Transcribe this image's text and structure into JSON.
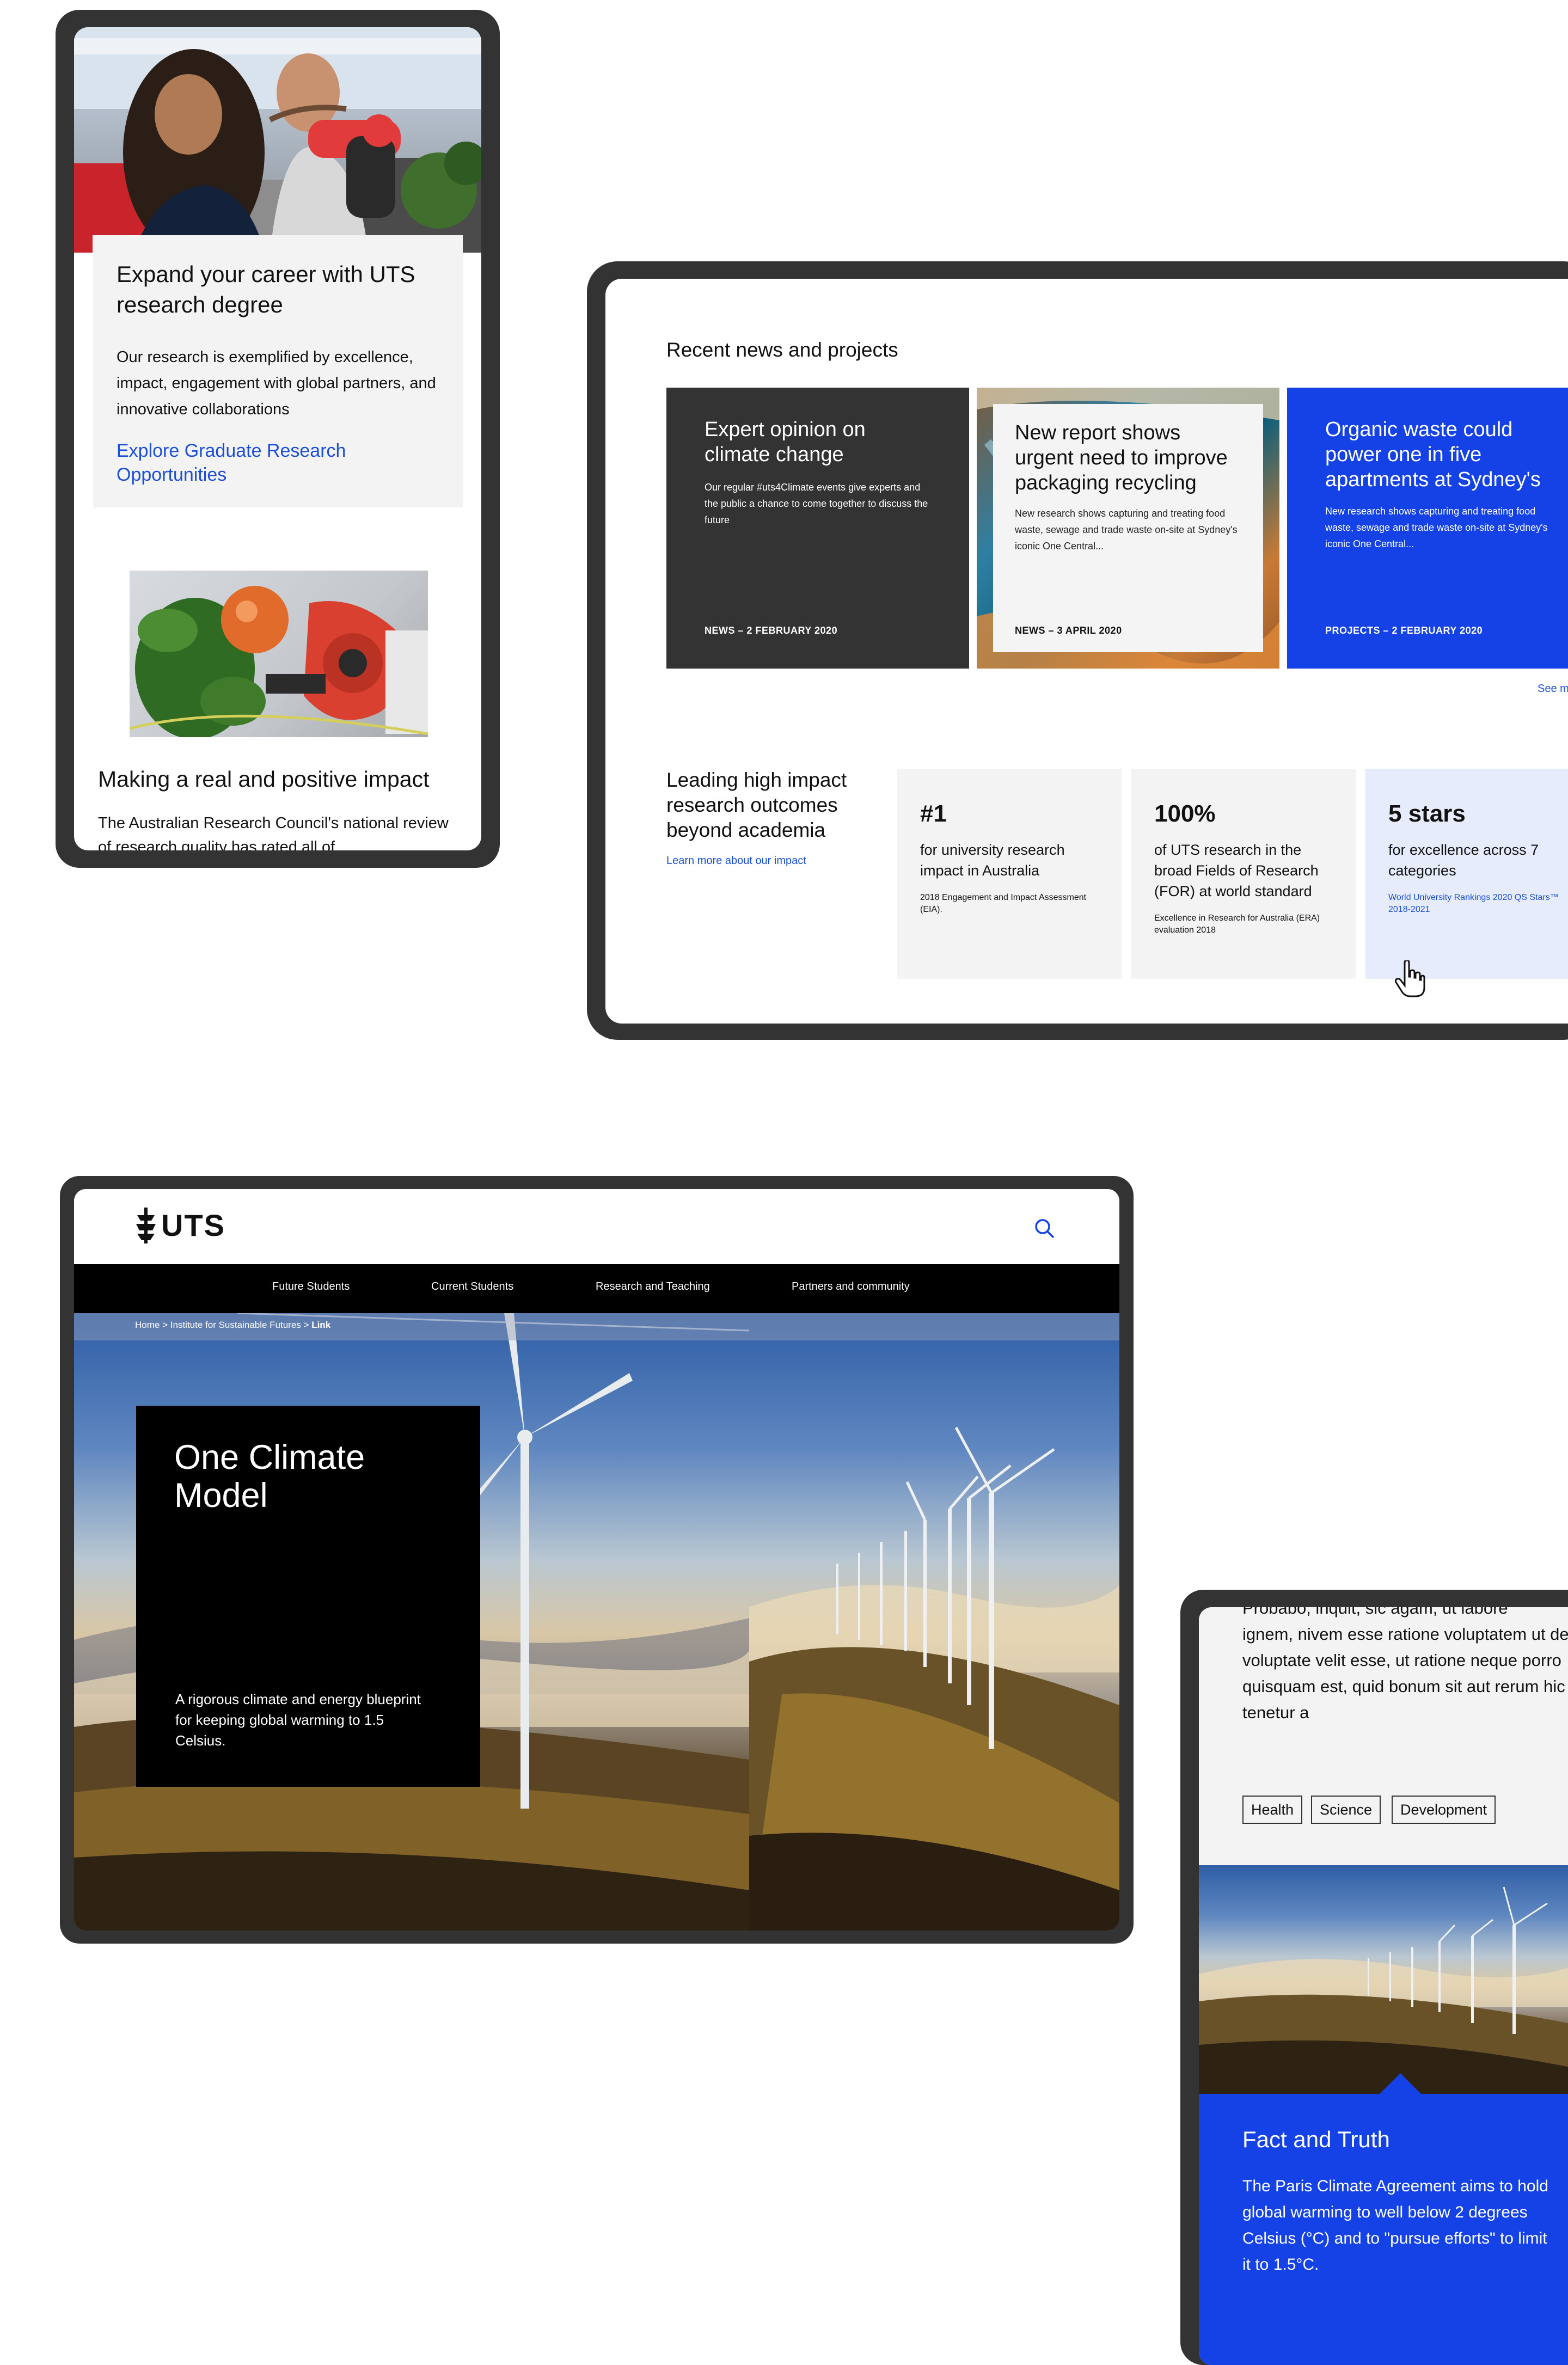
{
  "mobile_research": {
    "card1": {
      "title": "Expand your career with UTS research degree",
      "body": "Our research is exemplified by excellence, impact, engagement with global partners, and innovative collaborations",
      "link": "Explore Graduate Research Opportunities"
    },
    "card2": {
      "title": "Making a real and positive impact",
      "body": "The Australian Research Council's national review of research quality has rated all of"
    }
  },
  "tablet_news": {
    "section_title": "Recent news and projects",
    "cards": [
      {
        "title": "Expert opinion on climate change",
        "desc": "Our regular #uts4Climate events give experts and the public a chance to come together to discuss the future",
        "meta": "NEWS – 2 FEBRUARY 2020"
      },
      {
        "title": "New report shows urgent need to improve packaging recycling",
        "desc": "New research shows capturing and treating food waste, sewage and trade waste on-site at Sydney's iconic One Central...",
        "meta": "NEWS – 3 APRIL 2020"
      },
      {
        "title": "Organic waste could power one in five apartments at Sydney's",
        "desc": "New research shows capturing and treating food waste, sewage and trade waste on-site at Sydney's iconic One Central...",
        "meta": "PROJECTS – 2 FEBRUARY 2020"
      }
    ],
    "see_more": "See m",
    "impact_title": "Leading high impact research outcomes beyond academia",
    "impact_link": "Learn more about our impact",
    "stats": [
      {
        "value": "#1",
        "desc": "for university research impact in Australia",
        "source": "2018 Engagement and Impact Assessment (EIA)."
      },
      {
        "value": "100%",
        "desc": "of UTS research in the broad Fields of Research (FOR) at world standard",
        "source": "Excellence in Research for Australia (ERA) evaluation 2018"
      },
      {
        "value": "5 stars",
        "desc": "for excellence across 7 categories",
        "source": "World University Rankings 2020 QS Stars™ 2018-2021"
      }
    ]
  },
  "desktop_climate": {
    "logo_text": "UTS",
    "nav": [
      "Future Students",
      "Current Students",
      "Research and Teaching",
      "Partners and community"
    ],
    "breadcrumb": {
      "home": "Home",
      "sep1": ">",
      "section": "Institute for Sustainable Futures",
      "sep2": ">",
      "current": "Link"
    },
    "hero_title": "One Climate Model",
    "hero_desc": "A rigorous climate and energy blueprint for keeping global warming to 1.5 Celsius."
  },
  "mobile_fact": {
    "top_text_cut": "Probabo, inquit, sic agam, ut labore",
    "body": "ignem, nivem esse ratione voluptatem ut de voluptate velit esse, ut ratione neque porro quisquam est, quid bonum sit aut rerum hic tenetur a",
    "tags": [
      "Health",
      "Science",
      "Development"
    ],
    "fact_title": "Fact and Truth",
    "fact_body": "The Paris Climate Agreement aims to hold global warming to well below 2 degrees Celsius (°C) and to \"pursue efforts\" to limit it to 1.5°C."
  },
  "colors": {
    "brand_blue": "#1442e6",
    "dark_card": "#333333",
    "black_panel": "#000000",
    "light_gray": "#f3f3f3",
    "light_blue": "#e6ecfb",
    "link_blue": "#1b4fd8",
    "device_frame": "#333333"
  },
  "icons": [
    "search-icon",
    "hand-cursor-icon",
    "uts-logo-icon"
  ]
}
